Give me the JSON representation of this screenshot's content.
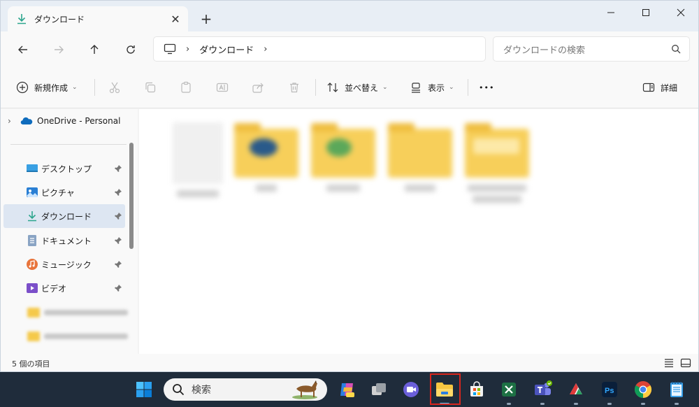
{
  "window": {
    "tab_title": "ダウンロード",
    "close_glyph": "✕",
    "new_tab_glyph": "+"
  },
  "address": {
    "segment": "ダウンロード",
    "separator": "›",
    "trailing_chevron": "›"
  },
  "search": {
    "placeholder": "ダウンロードの検索"
  },
  "toolbar": {
    "new_label": "新規作成",
    "sort_label": "並べ替え",
    "view_label": "表示",
    "more_label": "•••",
    "details_label": "詳細"
  },
  "sidebar": {
    "onedrive_label": "OneDrive - Personal",
    "items": [
      {
        "label": "デスクトップ"
      },
      {
        "label": "ピクチャ"
      },
      {
        "label": "ダウンロード"
      },
      {
        "label": "ドキュメント"
      },
      {
        "label": "ミュージック"
      },
      {
        "label": "ビデオ"
      }
    ]
  },
  "status": {
    "item_count": "5 個の項目"
  },
  "taskbar": {
    "search_label": "検索"
  },
  "colors": {
    "accent": "#0067c0",
    "download_green": "#2ca58d",
    "folder": "#f7cf5a",
    "highlight": "#d8261e"
  }
}
